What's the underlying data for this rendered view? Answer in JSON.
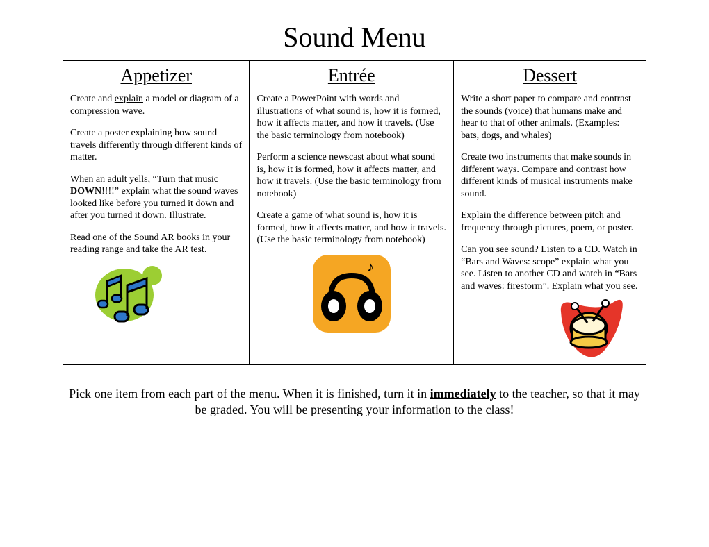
{
  "title": "Sound Menu",
  "columns": [
    {
      "header": "Appetizer",
      "items": [
        {
          "pre": "Create and ",
          "u": "explain",
          "post": " a model or diagram of a compression wave."
        },
        {
          "text": "Create a poster explaining how sound travels differently through different kinds of matter."
        },
        {
          "pre": "When an adult yells, “Turn that music ",
          "b": "DOWN",
          "post": "!!!!” explain what the sound waves looked like before you turned it down and after you turned it down.  Illustrate."
        },
        {
          "text": "Read one of the Sound AR books in your reading range and take the AR test."
        }
      ],
      "icon": "music-notes-icon"
    },
    {
      "header": "Entrée",
      "items": [
        {
          "text": "Create a PowerPoint with words and illustrations of what sound is, how it is formed, how it affects matter, and how it travels.  (Use the basic terminology from notebook)"
        },
        {
          "text": "Perform a science newscast about what sound is, how it is formed, how it affects matter, and how it travels.  (Use the basic terminology from notebook)"
        },
        {
          "text": "Create a game of what sound is, how it is formed, how it affects matter, and how it travels.  (Use the basic terminology from notebook)"
        }
      ],
      "icon": "headphones-icon"
    },
    {
      "header": "Dessert",
      "items": [
        {
          "text": "Write a short paper to compare and contrast the sounds (voice) that humans make and hear to that of other animals. (Examples: bats, dogs, and whales)"
        },
        {
          "text": "Create two instruments that make sounds in different ways.  Compare and contrast how different kinds of musical instruments make sound."
        },
        {
          "text": "Explain the difference between pitch and frequency through pictures, poem, or poster."
        },
        {
          "text": "Can you see sound?  Listen to a CD.  Watch in “Bars and Waves:  scope” explain what you see.  Listen to another CD and watch in “Bars and waves: firestorm”.  Explain what you see."
        }
      ],
      "icon": "drum-icon"
    }
  ],
  "footer": {
    "pre": "Pick one item from each part of the menu.  When it is finished, turn it in ",
    "u": "immediately",
    "post": " to the teacher, so that it may be graded.  You will be presenting your information to the class!"
  }
}
